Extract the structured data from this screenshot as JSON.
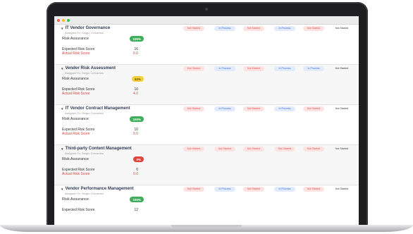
{
  "window": {
    "controls": [
      "close",
      "minimize",
      "maximize"
    ]
  },
  "status_labels": {
    "not_started": "Not Started",
    "in_process": "In Process"
  },
  "sections": [
    {
      "title": "IT Vendor Governance",
      "assigned": "Assigned To: Sergio Cervantes",
      "risk_assurance_label": "Risk Assurance",
      "risk_assurance_value": "100%",
      "expected_label": "Expected Risk Score",
      "expected_value": "16",
      "actual_label": "Actual Risk Score",
      "actual_value": "0.0",
      "statuses": [
        "Not Started",
        "In Process",
        "Not Started",
        "In Process",
        "Not Started",
        "Not Started"
      ]
    },
    {
      "title": "Vendor Risk Assessment",
      "assigned": "Assigned To: Sergio Cervantes",
      "risk_assurance_label": "Risk Assurance",
      "risk_assurance_value": "60%",
      "expected_label": "Expected Risk Score",
      "expected_value": "10",
      "actual_label": "Actual Risk Score",
      "actual_value": "4.0",
      "statuses": [
        "Not Started",
        "In Process",
        "Not Started",
        "In Process",
        "In Process",
        "Not Started"
      ]
    },
    {
      "title": "IT Vendor Contract Management",
      "assigned": "Assigned To: Sergio Cervantes",
      "risk_assurance_label": "Risk Assurance",
      "risk_assurance_value": "100%",
      "expected_label": "Expected Risk Score",
      "expected_value": "10",
      "actual_label": "Actual Risk Score",
      "actual_value": "0.0",
      "statuses": [
        "Not Started",
        "In Process",
        "Not Started",
        "In Process",
        "Not Started",
        "Not Started"
      ]
    },
    {
      "title": "Third-party Content Management",
      "assigned": "Assigned To: Sergio Cervantes",
      "risk_assurance_label": "Risk Assurance",
      "risk_assurance_value": "0%",
      "expected_label": "Expected Risk Score",
      "expected_value": "0",
      "actual_label": "Actual Risk Score",
      "actual_value": "0.0",
      "statuses": [
        "Not Started",
        "Not Started",
        "Not Started",
        "Not Started",
        "Not Started",
        "Not Started"
      ]
    },
    {
      "title": "Vendor Performance Management",
      "assigned": "Assigned To: Sergio Cervantes",
      "risk_assurance_label": "Risk Assurance",
      "risk_assurance_value": "100%",
      "expected_label": "Expected Risk Score",
      "expected_value": "12",
      "actual_label": "",
      "actual_value": "",
      "statuses": [
        "Not Started",
        "In Process",
        "Not Started",
        "In Process",
        "Not Started",
        "Not Started"
      ]
    }
  ],
  "colors": {
    "assurance_full": "#3fae5b",
    "assurance_partial": "#f4d03f",
    "assurance_none": "#e0443e",
    "actual_score": "#e0443e",
    "not_started": "#d9534f",
    "in_process": "#3f6fd1"
  }
}
